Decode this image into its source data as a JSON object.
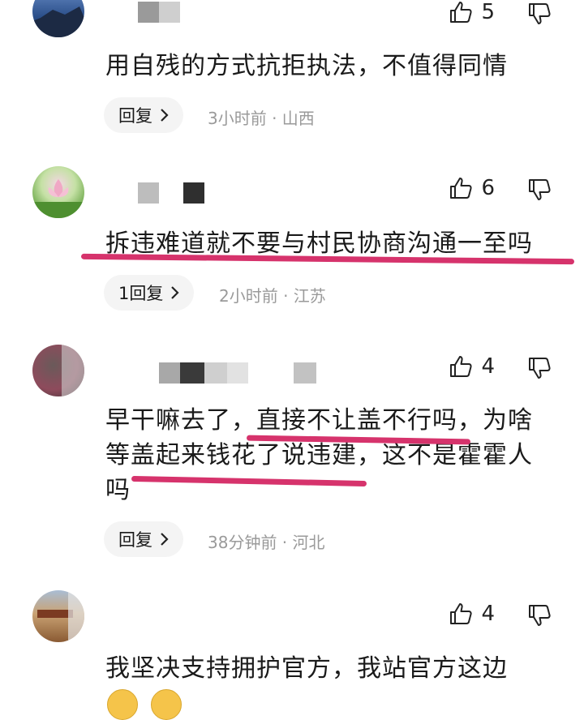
{
  "comments": [
    {
      "likes": "5",
      "text": "用自残的方式抗拒执法，不值得同情",
      "reply_label": "回复",
      "meta": "3小时前 · 山西"
    },
    {
      "likes": "6",
      "text": "拆违难道就不要与村民协商沟通一至吗",
      "reply_label": "1回复",
      "meta": "2小时前 · 江苏"
    },
    {
      "likes": "4",
      "text_line1": "早干嘛去了，直接不让盖不行吗，为啥",
      "text_line2": "等盖起来钱花了说违建，这不是霍霍人",
      "text_line3": "吗",
      "reply_label": "回复",
      "meta": "38分钟前 · 河北"
    },
    {
      "likes": "4",
      "text": "我坚决支持拥护官方，我站官方这边"
    }
  ],
  "colors": {
    "underline": "#d6336c",
    "meta": "#9a9a9a",
    "reply_bg": "#f4f4f4"
  },
  "icons": [
    "thumbs-up-icon",
    "thumbs-down-icon",
    "chevron-right-icon"
  ]
}
